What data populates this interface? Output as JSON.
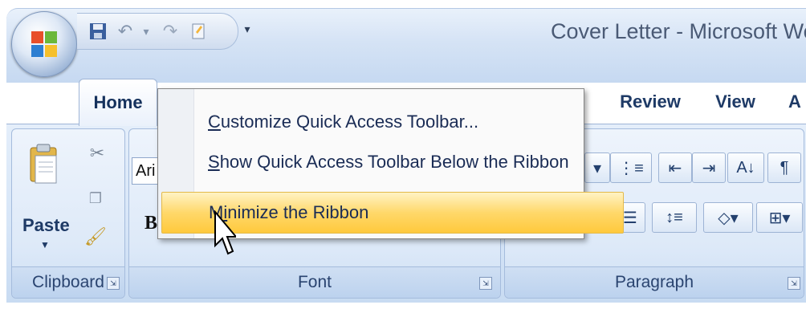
{
  "window": {
    "title": "Cover Letter - Microsoft Word"
  },
  "quick_access_toolbar": {
    "icons": [
      "save-icon",
      "undo-icon",
      "redo-icon",
      "repeat-icon"
    ],
    "dropdown_icon": "customize-dropdown-icon"
  },
  "tabs": [
    {
      "label": "Home",
      "active": true
    },
    {
      "label": "Review",
      "active": false
    },
    {
      "label": "View",
      "active": false
    },
    {
      "label": "A",
      "active": false
    }
  ],
  "ribbon": {
    "clipboard": {
      "label": "Clipboard",
      "paste_label": "Paste",
      "icons": [
        "paste-icon",
        "cut-icon",
        "copy-icon",
        "format-painter-icon"
      ]
    },
    "font": {
      "label": "Font",
      "font_name": "Ari",
      "bold_label": "B"
    },
    "paragraph": {
      "label": "Paragraph"
    }
  },
  "context_menu": {
    "items": [
      {
        "label": "Customize Quick Access Toolbar...",
        "accel": "C",
        "rest": "ustomize Quick Access Toolbar...",
        "highlighted": false
      },
      {
        "label": "Show Quick Access Toolbar Below the Ribbon",
        "accel": "S",
        "rest": "how Quick Access Toolbar Below the Ribbon",
        "highlighted": false
      },
      {
        "label": "Minimize the Ribbon",
        "pre": "M",
        "accel": "i",
        "rest": "nimize the Ribbon",
        "highlighted": true
      }
    ]
  },
  "colors": {
    "menu_highlight": "#ffd86a",
    "ribbon_blue": "#d6e5f7",
    "text_blue": "#1e3a66"
  }
}
